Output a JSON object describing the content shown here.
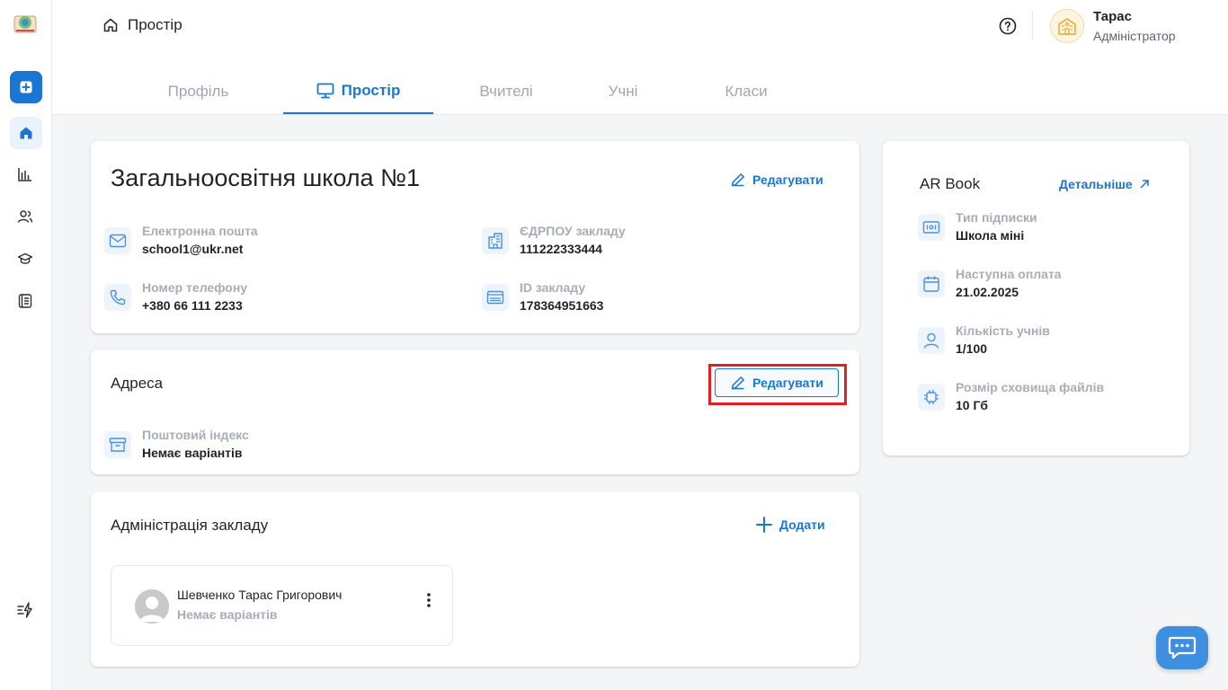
{
  "header": {
    "breadcrumb": "Простір",
    "user_name": "Тарас",
    "user_role": "Адміністратор"
  },
  "tabs": [
    {
      "label": "Профіль",
      "active": false
    },
    {
      "label": "Простір",
      "active": true
    },
    {
      "label": "Вчителі",
      "active": false
    },
    {
      "label": "Учні",
      "active": false
    },
    {
      "label": "Класи",
      "active": false
    }
  ],
  "school_card": {
    "title": "Загальноосвітня школа №1",
    "edit_label": "Редагувати",
    "fields": {
      "email": {
        "label": "Електронна пошта",
        "value": "school1@ukr.net",
        "icon": "mail-icon"
      },
      "edrpou": {
        "label": "ЄДРПОУ закладу",
        "value": "111222333444",
        "icon": "building-icon"
      },
      "phone": {
        "label": "Номер телефону",
        "value": "+380 66 111 2233",
        "icon": "phone-icon"
      },
      "school_id": {
        "label": "ID закладу",
        "value": "178364951663",
        "icon": "id-card-icon"
      }
    }
  },
  "address_card": {
    "title": "Адреса",
    "edit_label": "Редагувати",
    "postal": {
      "label": "Поштовий індекс",
      "value": "Немає варіантів",
      "icon": "archive-icon"
    }
  },
  "admin_card": {
    "title": "Адміністрація закладу",
    "add_label": "Додати",
    "people": [
      {
        "name": "Шевченко Тарас Григорович",
        "subtitle": "Немає варіантів"
      }
    ]
  },
  "subscription_card": {
    "title": "AR Book",
    "details_label": "Детальніше",
    "fields": {
      "type": {
        "label": "Тип підписки",
        "value": "Школа міні",
        "icon": "ticket-icon"
      },
      "next_payment": {
        "label": "Наступна оплата",
        "value": "21.02.2025",
        "icon": "calendar-icon"
      },
      "students": {
        "label": "Кількість учнів",
        "value": "1/100",
        "icon": "user-icon"
      },
      "storage": {
        "label": "Розмір сховища файлів",
        "value": "10 Гб",
        "icon": "chip-icon"
      }
    }
  },
  "colors": {
    "accent": "#1976d2",
    "highlight": "#e31e24",
    "chat": "#3f8fe0"
  }
}
